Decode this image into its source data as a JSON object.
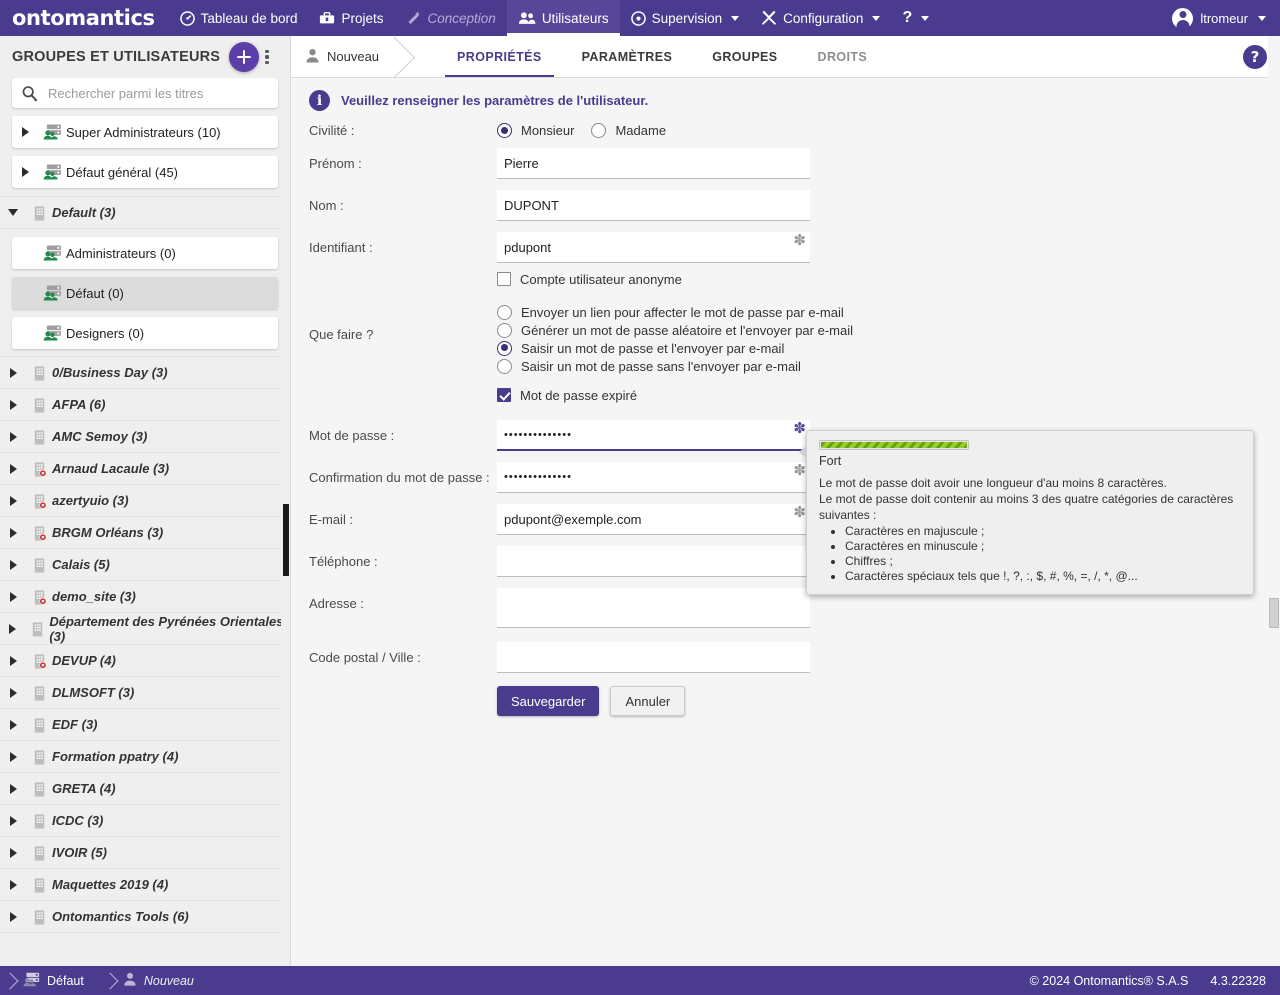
{
  "topnav": {
    "brand": "ontomantics",
    "items": [
      {
        "label": "Tableau de bord",
        "icon": "dashboard-icon",
        "state": "normal"
      },
      {
        "label": "Projets",
        "icon": "toolbox-icon",
        "state": "normal"
      },
      {
        "label": "Conception",
        "icon": "wand-icon",
        "state": "disabled"
      },
      {
        "label": "Utilisateurs",
        "icon": "users-icon",
        "state": "active"
      },
      {
        "label": "Supervision",
        "icon": "clock-icon",
        "state": "dropdown"
      },
      {
        "label": "Configuration",
        "icon": "tools-icon",
        "state": "dropdown"
      },
      {
        "label": "?",
        "icon": "help-icon",
        "state": "dropdown"
      }
    ],
    "user": {
      "label": "ltromeur",
      "icon": "avatar-icon"
    }
  },
  "sidebar": {
    "title": "GROUPES ET UTILISATEURS",
    "add_button": "+",
    "menu_icon": "kebab-menu-icon",
    "search": {
      "placeholder": "Rechercher parmi les titres",
      "value": "",
      "icon": "search-icon"
    },
    "top_groups": [
      {
        "label": "Super Administrateurs (10)",
        "icon": "users-group-icon",
        "expanded": false
      },
      {
        "label": "Défaut général (45)",
        "icon": "users-group-icon",
        "expanded": false
      }
    ],
    "tree": [
      {
        "label": "Default (3)",
        "icon": "building-icon",
        "expanded": true,
        "error": false,
        "children": [
          {
            "label": "Administrateurs (0)",
            "icon": "users-group-icon",
            "selected": false
          },
          {
            "label": "Défaut (0)",
            "icon": "users-group-icon",
            "selected": true
          },
          {
            "label": "Designers (0)",
            "icon": "users-group-icon",
            "selected": false
          }
        ]
      },
      {
        "label": "0/Business Day (3)",
        "icon": "building-icon",
        "expanded": false,
        "error": false
      },
      {
        "label": "AFPA (6)",
        "icon": "building-icon",
        "expanded": false,
        "error": false
      },
      {
        "label": "AMC Semoy (3)",
        "icon": "building-icon",
        "expanded": false,
        "error": false
      },
      {
        "label": "Arnaud Lacaule (3)",
        "icon": "building-error-icon",
        "expanded": false,
        "error": true
      },
      {
        "label": "azertyuio (3)",
        "icon": "building-error-icon",
        "expanded": false,
        "error": true
      },
      {
        "label": "BRGM Orléans (3)",
        "icon": "building-error-icon",
        "expanded": false,
        "error": true
      },
      {
        "label": "Calais (5)",
        "icon": "building-icon",
        "expanded": false,
        "error": false
      },
      {
        "label": "demo_site (3)",
        "icon": "building-error-icon",
        "expanded": false,
        "error": true
      },
      {
        "label": "Département des Pyrénées Orientales (3)",
        "icon": "building-icon",
        "expanded": false,
        "error": false
      },
      {
        "label": "DEVUP (4)",
        "icon": "building-error-icon",
        "expanded": false,
        "error": true
      },
      {
        "label": "DLMSOFT (3)",
        "icon": "building-icon",
        "expanded": false,
        "error": false
      },
      {
        "label": "EDF (3)",
        "icon": "building-icon",
        "expanded": false,
        "error": false
      },
      {
        "label": "Formation ppatry (4)",
        "icon": "building-icon",
        "expanded": false,
        "error": false
      },
      {
        "label": "GRETA (4)",
        "icon": "building-icon",
        "expanded": false,
        "error": false
      },
      {
        "label": "ICDC (3)",
        "icon": "building-icon",
        "expanded": false,
        "error": false
      },
      {
        "label": "IVOIR (5)",
        "icon": "building-icon",
        "expanded": false,
        "error": false
      },
      {
        "label": "Maquettes 2019 (4)",
        "icon": "building-icon",
        "expanded": false,
        "error": false
      },
      {
        "label": "Ontomantics Tools (6)",
        "icon": "building-icon",
        "expanded": false,
        "error": false
      }
    ]
  },
  "main": {
    "breadcrumb": {
      "label": "Nouveau",
      "icon": "person-icon"
    },
    "tabs": [
      {
        "label": "PROPRIÉTÉS",
        "active": true
      },
      {
        "label": "PARAMÈTRES",
        "active": false
      },
      {
        "label": "GROUPES",
        "active": false
      },
      {
        "label": "DROITS",
        "active": false
      }
    ],
    "help_button": "?",
    "info_message": "Veuillez renseigner les paramètres de l'utilisateur.",
    "form": {
      "civilite": {
        "label": "Civilité :",
        "options": [
          {
            "label": "Monsieur",
            "selected": true
          },
          {
            "label": "Madame",
            "selected": false
          }
        ]
      },
      "prenom": {
        "label": "Prénom :",
        "value": "Pierre",
        "required": false
      },
      "nom": {
        "label": "Nom :",
        "value": "DUPONT",
        "required": false
      },
      "identifiant": {
        "label": "Identifiant :",
        "value": "pdupont",
        "required": true
      },
      "anonyme": {
        "label": "Compte utilisateur anonyme",
        "checked": false
      },
      "que_faire": {
        "label": "Que faire ?",
        "options": [
          {
            "label": "Envoyer un lien pour affecter le mot de passe par e-mail",
            "selected": false
          },
          {
            "label": "Générer un mot de passe aléatoire et l'envoyer par e-mail",
            "selected": false
          },
          {
            "label": "Saisir un mot de passe et l'envoyer par e-mail",
            "selected": true
          },
          {
            "label": "Saisir un mot de passe sans l'envoyer par e-mail",
            "selected": false
          }
        ]
      },
      "expire": {
        "label": "Mot de passe expiré",
        "checked": true
      },
      "password": {
        "label": "Mot de passe :",
        "value": "••••••••••••••",
        "required": true,
        "focused": true
      },
      "password_confirm": {
        "label": "Confirmation du mot de passe :",
        "value": "••••••••••••••",
        "required": true
      },
      "email": {
        "label": "E-mail :",
        "value": "pdupont@exemple.com",
        "required": true
      },
      "telephone": {
        "label": "Téléphone :",
        "value": "",
        "required": false
      },
      "adresse": {
        "label": "Adresse :",
        "value": "",
        "required": false
      },
      "code_ville": {
        "label": "Code postal / Ville :",
        "value": "",
        "required": false
      },
      "save_label": "Sauvegarder",
      "cancel_label": "Annuler"
    },
    "password_tooltip": {
      "strength_label": "Fort",
      "strength_percent": 100,
      "strength_color": "#7cb518",
      "rule1": "Le mot de passe doit avoir une longueur d'au moins 8 caractères.",
      "rule2": "Le mot de passe doit contenir au moins 3 des quatre catégories de caractères suivantes :",
      "categories": [
        "Caractères en majuscule ;",
        "Caractères en minuscule ;",
        "Chiffres ;",
        "Caractères spéciaux tels que !, ?, :, $, #, %, =, /, *, @..."
      ]
    }
  },
  "footer": {
    "crumbs": [
      {
        "label": "Défaut",
        "icon": "users-group-icon",
        "italic": false
      },
      {
        "label": "Nouveau",
        "icon": "person-icon",
        "italic": true
      }
    ],
    "copyright": "© 2024 Ontomantics® S.A.S",
    "version": "4.3.22328"
  },
  "colors": {
    "brand": "#4b3b8f",
    "accent": "#5b3ea8",
    "sidebar_bg": "#efefef",
    "main_bg": "#f5f5f5"
  }
}
